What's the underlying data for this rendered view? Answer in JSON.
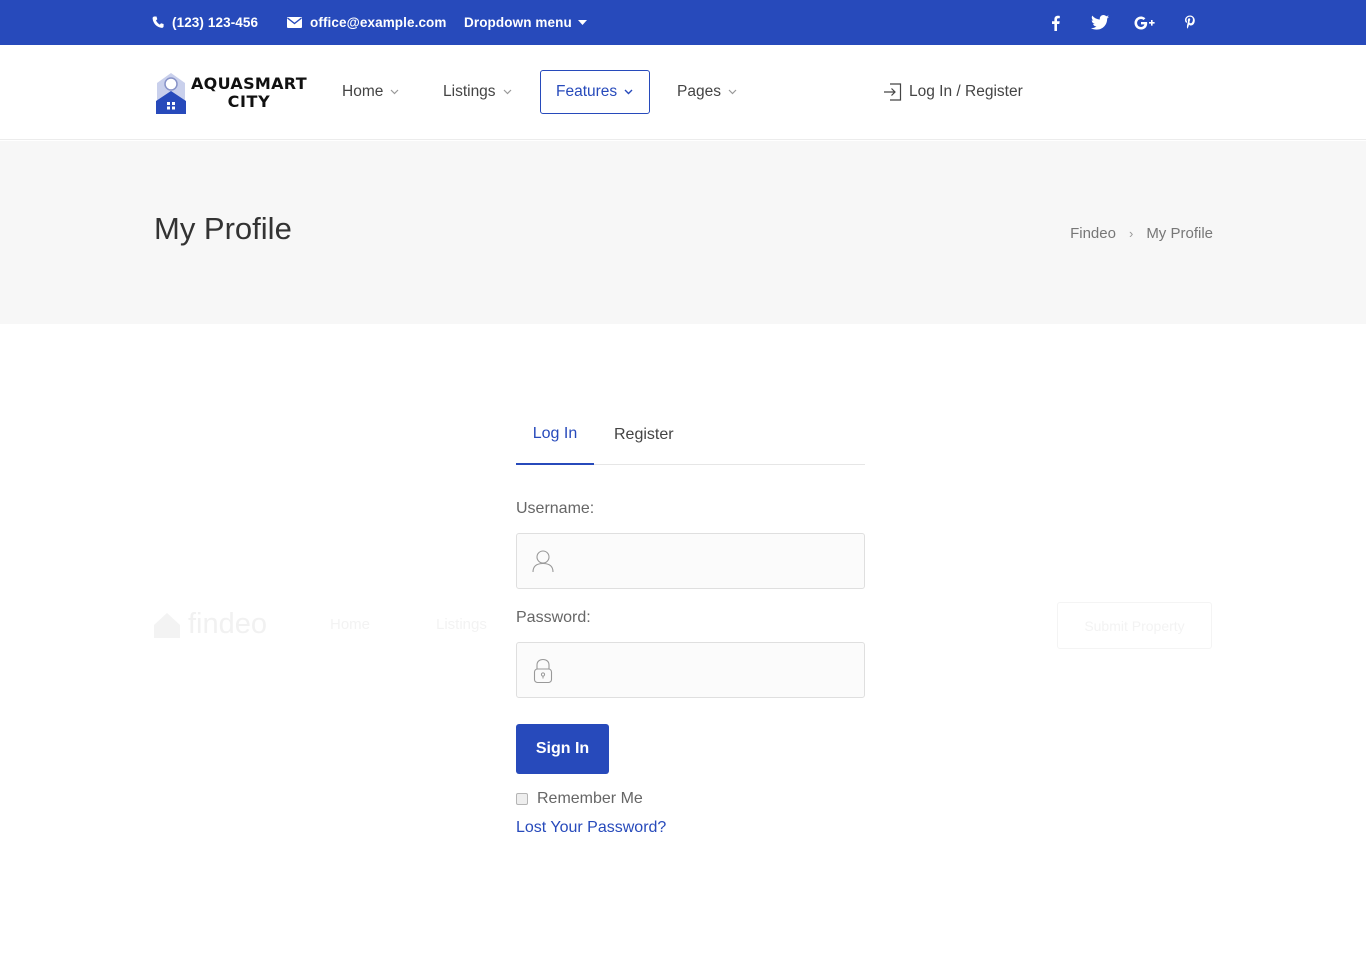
{
  "topbar": {
    "phone": "(123) 123-456",
    "email": "office@example.com",
    "dropdown": "Dropdown menu",
    "social": [
      "facebook-icon",
      "twitter-icon",
      "google-plus-icon",
      "pinterest-icon"
    ],
    "bg_color": "#274abb"
  },
  "header": {
    "logo_line1": "AQUASMART",
    "logo_line2": "CITY",
    "nav": {
      "home": "Home",
      "listings": "Listings",
      "features": "Features",
      "pages": "Pages"
    },
    "active_nav": "Features",
    "login_register": "Log In / Register"
  },
  "titlebar": {
    "title": "My Profile",
    "breadcrumbs": [
      "Findeo",
      "My Profile"
    ]
  },
  "ghost_header": {
    "logo": "findeo",
    "nav1": "Home",
    "nav2": "Listings",
    "button": "Submit Property"
  },
  "login": {
    "tabs": {
      "login": "Log In",
      "register": "Register"
    },
    "active_tab": "Log In",
    "username_label": "Username:",
    "username_value": "",
    "password_label": "Password:",
    "password_value": "",
    "signin_label": "Sign In",
    "remember_label": "Remember Me",
    "remember_checked": false,
    "lost_password": "Lost Your Password?"
  },
  "colors": {
    "accent": "#274abb",
    "titlebar_bg": "#f7f7f7"
  }
}
